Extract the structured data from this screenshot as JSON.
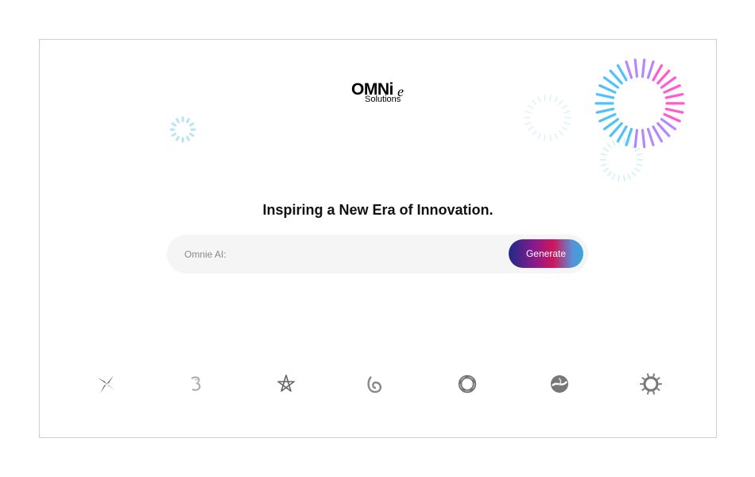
{
  "header": {
    "logo_main": "OMNi",
    "logo_accent": "e",
    "logo_sub": "Solutions"
  },
  "hero": {
    "headline": "Inspiring a New Era of Innovation."
  },
  "search": {
    "placeholder": "Omnie AI:",
    "value": "",
    "button_label": "Generate"
  },
  "decorations": [
    "burst-spinner-small",
    "burst-spinner-faint",
    "burst-firework",
    "burst-spinner-faint-lower"
  ],
  "brand_icons": [
    "pinwheel-icon",
    "swirl-three-icon",
    "star-knot-icon",
    "loop-leaf-icon",
    "donut-ring-icon",
    "orb-swoosh-icon",
    "gear-ring-icon"
  ],
  "colors": {
    "button_gradient": [
      "#1e2a8a",
      "#8a1a8c",
      "#d0165a",
      "#5a8fd8",
      "#37a8d8"
    ],
    "firework_blue": "#4fc3f7",
    "firework_purple": "#b388ff",
    "firework_pink": "#ff5ad0"
  }
}
